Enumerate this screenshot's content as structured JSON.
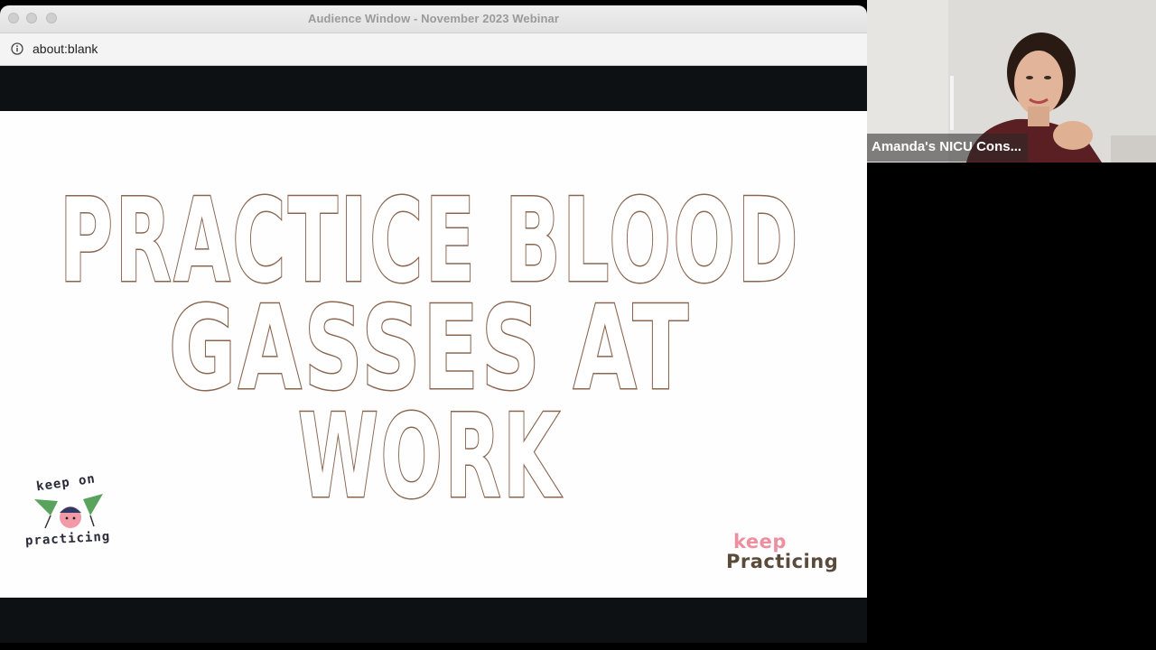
{
  "window": {
    "title": "Audience Window - November 2023 Webinar",
    "address_icon": "info-circle-icon",
    "url": "about:blank"
  },
  "slide": {
    "headline_lines": [
      "PRACTICE BLOOD",
      "GASSES AT",
      "WORK"
    ],
    "logo_left": {
      "top_text": "keep on",
      "bottom_text": "practicing"
    },
    "logo_right": {
      "top_text": "keep",
      "bottom_text": "Practicing"
    },
    "colors": {
      "outline": "#8a6550",
      "pink": "#ee8fa0",
      "green": "#5aa35c"
    }
  },
  "video": {
    "participant_name": "Amanda's NICU Cons..."
  }
}
